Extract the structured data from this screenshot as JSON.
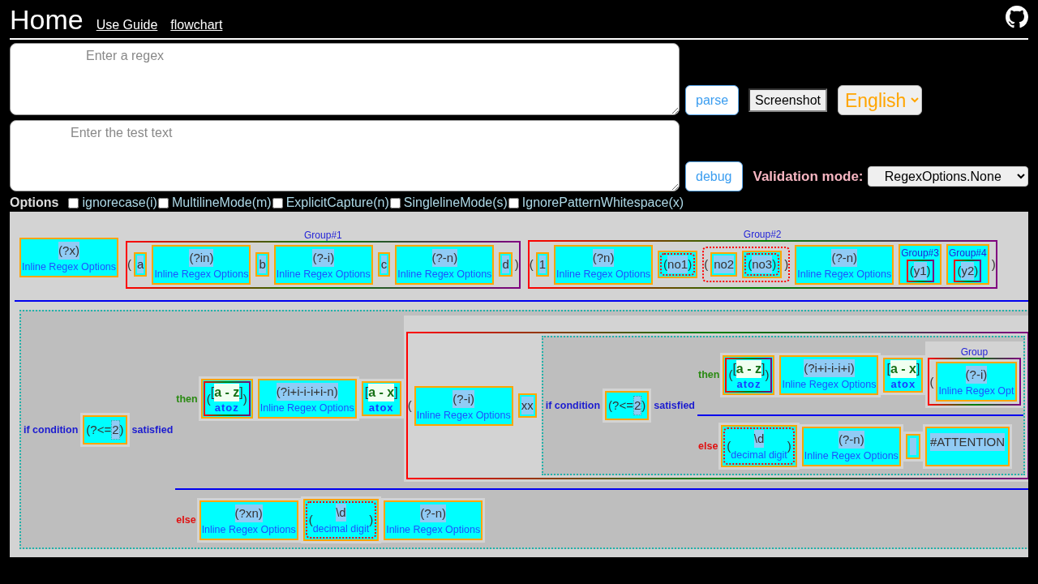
{
  "header": {
    "title": "Home",
    "links": [
      "Use Guide",
      "flowchart"
    ]
  },
  "regex_input": {
    "placeholder": "Enter a regex"
  },
  "parse_button": {
    "label": "parse"
  },
  "screenshot_button": {
    "label": "Screenshot"
  },
  "language_select": {
    "value": "English"
  },
  "test_input": {
    "placeholder": "Enter the test text"
  },
  "debug_button": {
    "label": "debug"
  },
  "validation_mode": {
    "label": "Validation mode:",
    "value": "RegexOptions.None"
  },
  "options": {
    "label": "Options",
    "items": [
      {
        "label": "ignorecase(i)",
        "checked": false
      },
      {
        "label": "MultilineMode(m)",
        "checked": false
      },
      {
        "label": "ExplicitCapture(n)",
        "checked": false
      },
      {
        "label": "SinglelineMode(s)",
        "checked": false
      },
      {
        "label": "IgnorePatternWhitespace(x)",
        "checked": false
      }
    ]
  },
  "diagram": {
    "alternatives": [
      {
        "items": [
          {
            "kind": "option",
            "text": "(?x)",
            "label": "Inline Regex Options"
          },
          {
            "kind": "group",
            "label": "Group#1",
            "open": "(",
            "close": ")",
            "items": [
              {
                "kind": "literal",
                "text": "a"
              },
              {
                "kind": "option",
                "text": "(?in)",
                "label": "Inline Regex Options"
              },
              {
                "kind": "literal",
                "text": "b"
              },
              {
                "kind": "option",
                "text": "(?-i)",
                "label": "Inline Regex Options"
              },
              {
                "kind": "literal",
                "text": "c"
              },
              {
                "kind": "option",
                "text": "(?-n)",
                "label": "Inline Regex Options"
              },
              {
                "kind": "literal",
                "text": "d"
              }
            ]
          },
          {
            "kind": "group",
            "label": "Group#2",
            "open": "(",
            "close": ")",
            "items": [
              {
                "kind": "literal",
                "text": "1"
              },
              {
                "kind": "option",
                "text": "(?n)",
                "label": "Inline Regex Options"
              },
              {
                "kind": "plain_group_box",
                "open": "(",
                "close": ")",
                "content": {
                  "kind": "literal",
                  "text": "no1"
                }
              },
              {
                "kind": "plain_group",
                "open": "(",
                "close": ")",
                "items": [
                  {
                    "kind": "literal",
                    "text": "no2"
                  },
                  {
                    "kind": "plain_group_box",
                    "open": "(",
                    "close": ")",
                    "content": {
                      "kind": "literal",
                      "text": "no3"
                    }
                  }
                ]
              },
              {
                "kind": "option",
                "text": "(?-n)",
                "label": "Inline Regex Options"
              },
              {
                "kind": "group_box",
                "label": "Group#3",
                "open": "(",
                "close": ")",
                "content": {
                  "kind": "literal",
                  "text": "y1"
                }
              },
              {
                "kind": "group_box",
                "label": "Group#4",
                "open": "(",
                "close": ")",
                "content": {
                  "kind": "literal",
                  "text": "y2"
                }
              }
            ]
          }
        ]
      },
      {
        "items": [
          {
            "kind": "conditional",
            "if_label": "if condition",
            "condition": {
              "kind": "lookaround",
              "open": "(?<=",
              "text": "2",
              "close": ")"
            },
            "satisfied_label": "satisfied",
            "branches": [
              {
                "kind": "then",
                "label": "then",
                "items": [
                  {
                    "kind": "group_box",
                    "open": "(",
                    "close": ")",
                    "content": {
                      "kind": "class",
                      "open": "[",
                      "text": "a - z",
                      "close": "]",
                      "label": "atoz"
                    }
                  },
                  {
                    "kind": "option",
                    "text": "(?i+i-i-i+i-n)",
                    "label": "Inline Regex Options"
                  },
                  {
                    "kind": "class",
                    "open": "[",
                    "text": "a - x",
                    "close": "]",
                    "label": "atox"
                  },
                  {
                    "kind": "group",
                    "open": "(",
                    "items": [
                      {
                        "kind": "option",
                        "text": "(?-i)",
                        "label": "Inline Regex Options"
                      },
                      {
                        "kind": "literal",
                        "text": "xx"
                      },
                      {
                        "kind": "conditional",
                        "if_label": "if condition",
                        "condition": {
                          "kind": "lookaround",
                          "open": "(?<=",
                          "text": "2",
                          "close": ")"
                        },
                        "satisfied_label": "satisfied",
                        "branches": [
                          {
                            "kind": "then",
                            "label": "then",
                            "items": [
                              {
                                "kind": "group_box",
                                "open": "(",
                                "close": ")",
                                "content": {
                                  "kind": "class",
                                  "open": "[",
                                  "text": "a - z",
                                  "close": "]",
                                  "label": "atoz"
                                }
                              },
                              {
                                "kind": "option",
                                "text": "(?i+i-i-i+i)",
                                "label": "Inline Regex Options"
                              },
                              {
                                "kind": "class",
                                "open": "[",
                                "text": "a - x",
                                "close": "]",
                                "label": "atox"
                              },
                              {
                                "kind": "group",
                                "label": "Group",
                                "open": "(",
                                "items": [
                                  {
                                    "kind": "option",
                                    "text": "(?-i)",
                                    "label": "Inline Regex Opt"
                                  }
                                ]
                              }
                            ]
                          },
                          {
                            "kind": "else",
                            "label": "else",
                            "items": [
                              {
                                "kind": "plain_group_box",
                                "open": "(",
                                "close": ")",
                                "content": {
                                  "kind": "escape",
                                  "text": "\\d",
                                  "label": "decimal digit"
                                }
                              },
                              {
                                "kind": "option",
                                "text": "(?-n)",
                                "label": "Inline Regex Options"
                              },
                              {
                                "kind": "space"
                              },
                              {
                                "kind": "comment",
                                "text": "#ATTENTION"
                              }
                            ]
                          }
                        ]
                      }
                    ]
                  }
                ]
              },
              {
                "kind": "else",
                "label": "else",
                "items": [
                  {
                    "kind": "option",
                    "text": "(?xn)",
                    "label": "Inline Regex Options"
                  },
                  {
                    "kind": "plain_group_box",
                    "open": "(",
                    "close": ")",
                    "content": {
                      "kind": "escape",
                      "text": "\\d",
                      "label": "decimal digit"
                    }
                  },
                  {
                    "kind": "option",
                    "text": "(?-n)",
                    "label": "Inline Regex Options"
                  }
                ]
              }
            ]
          }
        ]
      }
    ]
  }
}
